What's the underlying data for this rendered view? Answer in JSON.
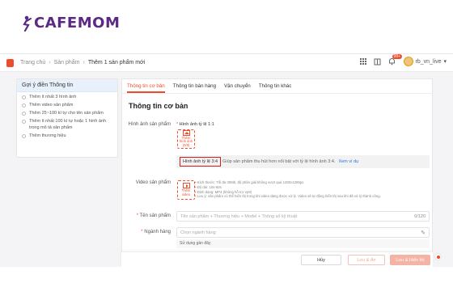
{
  "brand": {
    "name": "CAFEMOM",
    "color": "#5b2a86"
  },
  "topbar": {
    "breadcrumb": [
      "Trang chủ",
      "Sản phẩm",
      "Thêm 1 sản phẩm mới"
    ],
    "notification_count": "99+",
    "username": "rb_vn_live",
    "icons": [
      "grid-icon",
      "book-icon",
      "bell-icon"
    ]
  },
  "sidebar": {
    "title": "Gợi ý điền Thông tin",
    "tips": [
      "Thêm ít nhất 3 hình ảnh",
      "Thêm video sản phẩm",
      "Thêm 25~100 kí tự cho tên sản phẩm",
      "Thêm ít nhất 100 kí tự hoặc 1 hình ảnh trong mô tả sản phẩm",
      "Thêm thương hiệu"
    ]
  },
  "tabs": [
    "Thông tin cơ bản",
    "Thông tin bán hàng",
    "Vận chuyển",
    "Thông tin khác"
  ],
  "section_title": "Thông tin cơ bản",
  "images": {
    "label": "Hình ảnh sản phẩm",
    "ratio": "Hình ảnh tỷ lệ 1:1",
    "upload_label": "Thêm hình ảnh (0/9)"
  },
  "notice": {
    "highlight": "Hình ảnh tỷ lệ 3:4",
    "text": "Giúp sản phẩm thu hút hơn nổi bật với tỷ lệ hình ảnh 3:4.",
    "link": "Xem ví dụ"
  },
  "video": {
    "label": "Video sản phẩm",
    "upload_label": "Thêm video",
    "notes": [
      "Kích thước: Tối đa 30Mb, độ phân giải không vượt quá 1280x1280px",
      "Độ dài: 10s-60s",
      "Định dạng: MP4 (không hỗ trợ vp9)",
      "Lưu ý: sản phẩm có thể hiển thị trong khi video đang được xử lý. Video sẽ tự động hiển thị sau khi đã xử lý thành công."
    ]
  },
  "name_field": {
    "label": "Tên sản phẩm",
    "placeholder": "Tên sản phẩm + Thương hiệu + Model + Thông số kỹ thuật",
    "counter": "0/120"
  },
  "category_field": {
    "label": "Ngành hàng",
    "placeholder": "Chọn ngành hàng",
    "used_note": "Sử dụng gần đây"
  },
  "footer": {
    "cancel": "Hủy",
    "save_hide": "Lưu & Ẩn",
    "save_show": "Lưu & Hiển thị"
  },
  "colors": {
    "accent": "#ee4d2d",
    "link": "#2673dd",
    "highlight_border": "#d81b1b"
  }
}
